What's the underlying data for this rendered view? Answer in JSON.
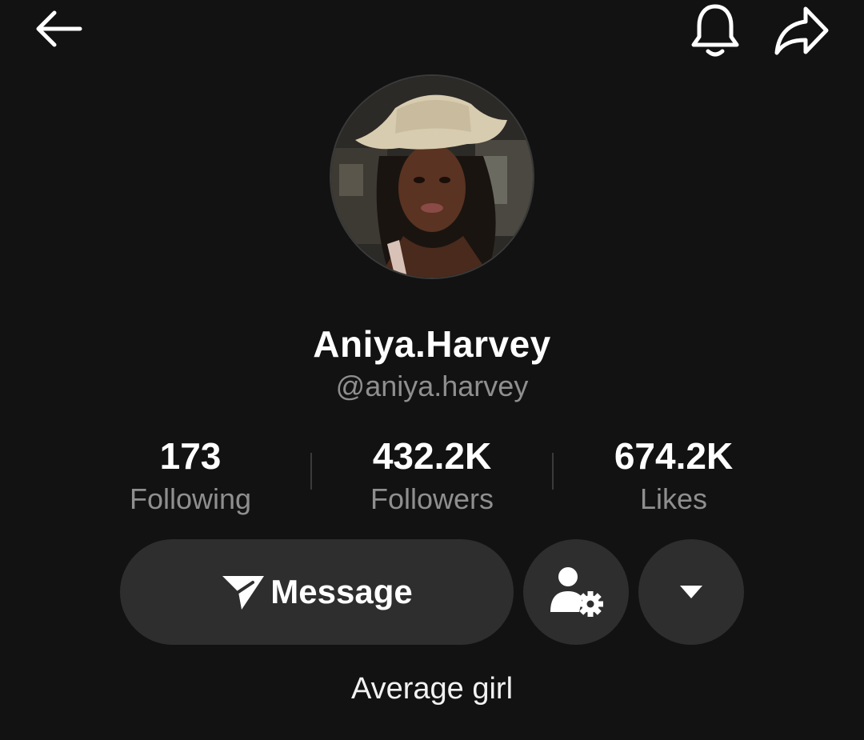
{
  "header": {
    "back_icon": "arrow-left-icon",
    "bell_icon": "bell-icon",
    "share_icon": "share-arrow-icon"
  },
  "profile": {
    "display_name": "Aniya.Harvey",
    "handle": "@aniya.harvey",
    "bio": "Average girl"
  },
  "stats": [
    {
      "value": "173",
      "label": "Following"
    },
    {
      "value": "432.2K",
      "label": "Followers"
    },
    {
      "value": "674.2K",
      "label": "Likes"
    }
  ],
  "actions": {
    "message_label": "Message",
    "message_icon": "send-arrow-icon",
    "friends_icon": "person-gear-icon",
    "more_icon": "caret-down-icon"
  },
  "colors": {
    "background": "#121212",
    "button_bg": "#2e2e2e",
    "secondary_text": "#8f8f8f",
    "primary_text": "#ffffff"
  }
}
